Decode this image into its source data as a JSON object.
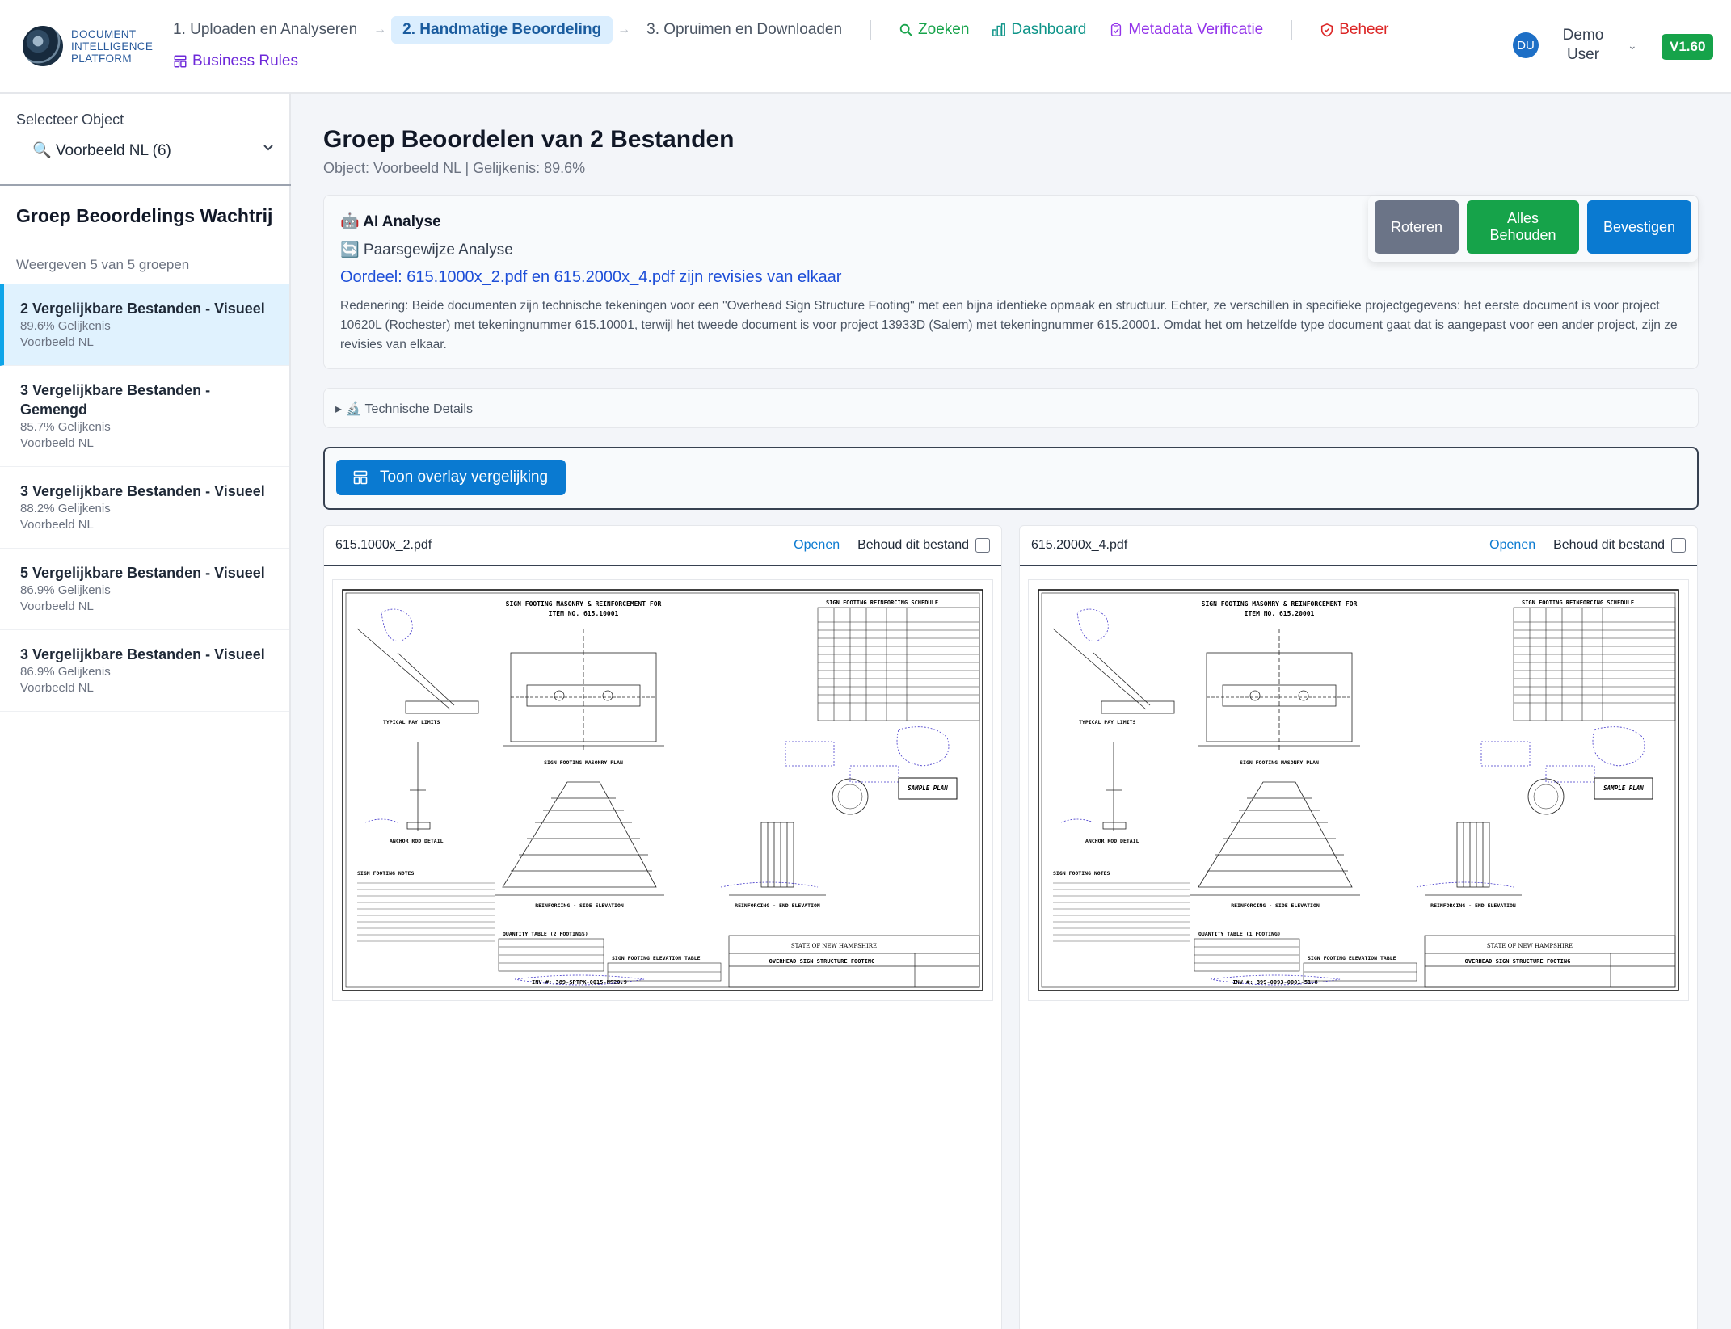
{
  "app": {
    "logo_lines": [
      "DOCUMENT",
      "INTELLIGENCE",
      "PLATFORM"
    ],
    "version": "V1.60"
  },
  "nav": {
    "steps": [
      "1. Uploaden en Analyseren",
      "2. Handmatige Beoordeling",
      "3. Opruimen en Downloaden"
    ],
    "active_step": 1,
    "links": {
      "search": "Zoeken",
      "dashboard": "Dashboard",
      "metadata": "Metadata Verificatie",
      "admin": "Beheer",
      "business": "Business Rules"
    }
  },
  "user": {
    "initials": "DU",
    "name_line1": "Demo",
    "name_line2": "User"
  },
  "sidebar": {
    "select_label": "Selecteer Object",
    "selected_object": "🔍 Voorbeeld NL (6)",
    "queue_title": "Groep Beoordelings Wachtrij",
    "queue_count": "Weergeven 5 van 5 groepen",
    "groups": [
      {
        "name": "2 Vergelijkbare Bestanden - Visueel",
        "similarity": "89.6% Gelijkenis",
        "object": "Voorbeeld NL"
      },
      {
        "name": "3 Vergelijkbare Bestanden - Gemengd",
        "similarity": "85.7% Gelijkenis",
        "object": "Voorbeeld NL"
      },
      {
        "name": "3 Vergelijkbare Bestanden - Visueel",
        "similarity": "88.2% Gelijkenis",
        "object": "Voorbeeld NL"
      },
      {
        "name": "5 Vergelijkbare Bestanden - Visueel",
        "similarity": "86.9% Gelijkenis",
        "object": "Voorbeeld NL"
      },
      {
        "name": "3 Vergelijkbare Bestanden - Visueel",
        "similarity": "86.9% Gelijkenis",
        "object": "Voorbeeld NL"
      }
    ]
  },
  "main": {
    "title": "Groep Beoordelen van 2 Bestanden",
    "subtitle": "Object: Voorbeeld NL | Gelijkenis: 89.6%",
    "ai": {
      "title": "🤖 AI Analyse",
      "pair_label": "🔄 Paarsgewijze Analyse",
      "verdict": "Oordeel: 615.1000x_2.pdf en 615.2000x_4.pdf zijn revisies van elkaar",
      "reasoning": "Redenering: Beide documenten zijn technische tekeningen voor een \"Overhead Sign Structure Footing\" met een bijna identieke opmaak en structuur. Echter, ze verschillen in specifieke projectgegevens: het eerste document is voor project 10620L (Rochester) met tekeningnummer 615.10001, terwijl het tweede document is voor project 13933D (Salem) met tekeningnummer 615.20001. Omdat het om hetzelfde type document gaat dat is aangepast voor een ander project, zijn ze revisies van elkaar."
    },
    "actions": {
      "rotate": "Roteren",
      "keep_all": "Alles Behouden",
      "confirm": "Bevestigen"
    },
    "technical_details": "▸ 🔬 Technische Details",
    "overlay_button": "Toon overlay vergelijking",
    "files": [
      {
        "name": "615.1000x_2.pdf",
        "open": "Openen",
        "keep": "Behoud dit bestand",
        "drawing": {
          "title_line1": "SIGN FOOTING MASONRY & REINFORCEMENT FOR",
          "item_no": "ITEM NO. 615.10001",
          "schedule": "SIGN FOOTING REINFORCING SCHEDULE",
          "plan": "SIGN FOOTING MASONRY PLAN",
          "sample_plan": "SAMPLE PLAN",
          "anchor": "ANCHOR ROD DETAIL",
          "typical": "TYPICAL PAY LIMITS",
          "notes": "SIGN FOOTING NOTES",
          "side_elev": "REINFORCING - SIDE ELEVATION",
          "end_elev": "REINFORCING - END ELEVATION",
          "quantity": "QUANTITY TABLE (2 FOOTINGS)",
          "elev_table": "SIGN FOOTING ELEVATION TABLE",
          "state": "STATE OF NEW HAMPSHIRE",
          "structure": "OVERHEAD SIGN STRUCTURE FOOTING",
          "inv": "INV #: 389-SPTPK-0015-NS20.9"
        }
      },
      {
        "name": "615.2000x_4.pdf",
        "open": "Openen",
        "keep": "Behoud dit bestand",
        "drawing": {
          "title_line1": "SIGN FOOTING MASONRY & REINFORCEMENT FOR",
          "item_no": "ITEM NO. 615.20001",
          "schedule": "SIGN FOOTING REINFORCING SCHEDULE",
          "plan": "SIGN FOOTING MASONRY PLAN",
          "sample_plan": "SAMPLE PLAN",
          "anchor": "ANCHOR ROD DETAIL",
          "typical": "TYPICAL PAY LIMITS",
          "notes": "SIGN FOOTING NOTES",
          "side_elev": "REINFORCING - SIDE ELEVATION",
          "end_elev": "REINFORCING - END ELEVATION",
          "quantity": "QUANTITY TABLE (1 FOOTING)",
          "elev_table": "SIGN FOOTING ELEVATION TABLE",
          "state": "STATE OF NEW HAMPSHIRE",
          "structure": "OVERHEAD SIGN STRUCTURE FOOTING",
          "inv": "INV #: 399-0093-0001-51.8"
        }
      }
    ]
  },
  "colors": {
    "primary": "#0a7ad1",
    "success": "#16a34a",
    "danger": "#dc2626",
    "purple": "#9333ea",
    "muted_button": "#6b7487",
    "active_row": "#e0f2fe"
  }
}
